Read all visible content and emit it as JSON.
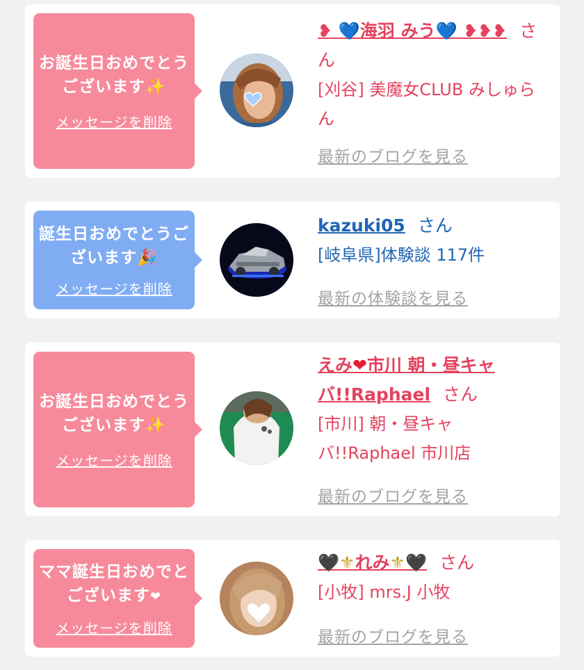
{
  "cards": [
    {
      "bubble_color": "#f68a9b",
      "message": "お誕生日おめでとうございます",
      "message_emoji": "✨",
      "delete_label": "メッセージを削除",
      "name_prefix": "❥ ",
      "name_heart_left": "💙",
      "name_main": "海羽 みう",
      "name_heart_right": "💙",
      "name_suffix": " ❥❥❥",
      "honorific": "さん",
      "shop": "[刈谷] 美魔女CLUB みしゅらん",
      "more_label": "最新のブログを見る",
      "avatar_icon": "profile-photo-blue-heart"
    },
    {
      "bubble_color": "#80acf3",
      "message": "誕生日おめでとうございます",
      "message_emoji": "🎉",
      "delete_label": "メッセージを削除",
      "name": "kazuki05",
      "honorific": "さん",
      "shop": "[岐阜県]体験談 117件",
      "more_label": "最新の体験談を見る",
      "avatar_icon": "car-photo"
    },
    {
      "bubble_color": "#f68a9b",
      "message": "お誕生日おめでとうございます",
      "message_emoji": "✨",
      "delete_label": "メッセージを削除",
      "name_part1": "えみ",
      "name_heart": "❤",
      "name_part2": "市川 朝・昼キャバ!!Raphael",
      "honorific": "さん",
      "shop": "[市川] 朝・昼キャバ!!Raphael 市川店",
      "more_label": "最新のブログを見る",
      "avatar_icon": "profile-photo"
    },
    {
      "bubble_color": "#f68a9b",
      "message": "ママ誕生日おめでとございます",
      "message_emoji": "❤",
      "delete_label": "メッセージを削除",
      "name_heart_left": "🖤",
      "name_fleur_left": "⚜",
      "name_main": "れみ",
      "name_fleur_right": "⚜",
      "name_heart_right": "🖤",
      "honorific": "さん",
      "shop": "[小牧] mrs.J 小牧",
      "more_label": "最新のブログを見る",
      "avatar_icon": "profile-photo-white-heart"
    }
  ]
}
